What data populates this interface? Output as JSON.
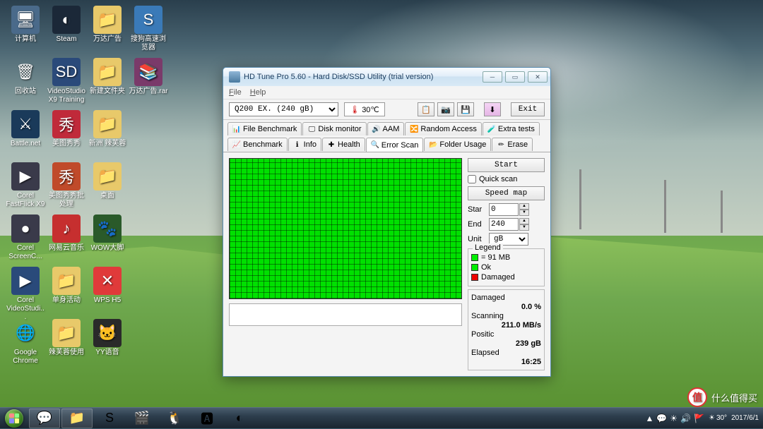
{
  "desktop_icons": [
    {
      "row": 0,
      "col": 0,
      "label": "计算机",
      "bg": "#4a6a8a",
      "glyph": "🖥"
    },
    {
      "row": 0,
      "col": 1,
      "label": "Steam",
      "bg": "#1b2838",
      "glyph": "◐"
    },
    {
      "row": 0,
      "col": 2,
      "label": "万达广告",
      "bg": "#e8c96a",
      "glyph": "📁"
    },
    {
      "row": 0,
      "col": 3,
      "label": "搜狗高速浏览器",
      "bg": "#3a7ab8",
      "glyph": "S"
    },
    {
      "row": 1,
      "col": 0,
      "label": "回收站",
      "bg": "transparent",
      "glyph": "🗑"
    },
    {
      "row": 1,
      "col": 1,
      "label": "VideoStudio X9 Training",
      "bg": "#2a4a7a",
      "glyph": "SD"
    },
    {
      "row": 1,
      "col": 2,
      "label": "新建文件夹",
      "bg": "#e8c96a",
      "glyph": "📁"
    },
    {
      "row": 1,
      "col": 3,
      "label": "万达广告.rar",
      "bg": "#7a3a6a",
      "glyph": "📚"
    },
    {
      "row": 2,
      "col": 0,
      "label": "Battle.net",
      "bg": "#1a3a5a",
      "glyph": "⚔"
    },
    {
      "row": 2,
      "col": 1,
      "label": "美图秀秀",
      "bg": "#c02a3a",
      "glyph": "秀"
    },
    {
      "row": 2,
      "col": 2,
      "label": "新洲 辣芙蓉",
      "bg": "#e8c96a",
      "glyph": "📁"
    },
    {
      "row": 3,
      "col": 0,
      "label": "Corel FastFlick X9",
      "bg": "#3a3a4a",
      "glyph": "▶"
    },
    {
      "row": 3,
      "col": 1,
      "label": "美图秀秀批处理",
      "bg": "#c04a2a",
      "glyph": "秀"
    },
    {
      "row": 3,
      "col": 2,
      "label": "桌面",
      "bg": "#e8c96a",
      "glyph": "📁"
    },
    {
      "row": 4,
      "col": 0,
      "label": "Corel ScreenC...",
      "bg": "#3a3a4a",
      "glyph": "●"
    },
    {
      "row": 4,
      "col": 1,
      "label": "网易云音乐",
      "bg": "#c62f2f",
      "glyph": "♪"
    },
    {
      "row": 4,
      "col": 2,
      "label": "WOW大脚",
      "bg": "#2a5a2a",
      "glyph": "🐾"
    },
    {
      "row": 5,
      "col": 0,
      "label": "Corel VideoStudi...",
      "bg": "#2a4a7a",
      "glyph": "▶"
    },
    {
      "row": 5,
      "col": 1,
      "label": "单身活动",
      "bg": "#e8c96a",
      "glyph": "📁"
    },
    {
      "row": 5,
      "col": 2,
      "label": "WPS H5",
      "bg": "#e03a3a",
      "glyph": "✕"
    },
    {
      "row": 6,
      "col": 0,
      "label": "Google Chrome",
      "bg": "transparent",
      "glyph": "🌐"
    },
    {
      "row": 6,
      "col": 1,
      "label": "辣芙蓉使用",
      "bg": "#e8c96a",
      "glyph": "📁"
    },
    {
      "row": 6,
      "col": 2,
      "label": "YY语音",
      "bg": "#2a2a2a",
      "glyph": "🐱"
    }
  ],
  "taskbar": {
    "pinned": [
      "💬",
      "📁",
      "S",
      "🎬",
      "🐧",
      "🅰",
      "◐"
    ],
    "tray_icons": [
      "▲",
      "💬",
      "☀",
      "🔊",
      "🚩"
    ],
    "temp": "30°",
    "time": "",
    "date": "2017/6/1"
  },
  "window": {
    "title": "HD Tune Pro 5.60 - Hard Disk/SSD Utility (trial version)",
    "menu": {
      "file": "File",
      "help": "Help"
    },
    "drive": "Q200 EX. (240 gB)",
    "temperature": "30℃",
    "exit": "Exit",
    "tabs_row1": [
      {
        "icon": "📊",
        "label": "File Benchmark"
      },
      {
        "icon": "🖵",
        "label": "Disk monitor"
      },
      {
        "icon": "🔊",
        "label": "AAM"
      },
      {
        "icon": "🔀",
        "label": "Random Access"
      },
      {
        "icon": "🧪",
        "label": "Extra tests"
      }
    ],
    "tabs_row2": [
      {
        "icon": "📈",
        "label": "Benchmark"
      },
      {
        "icon": "ℹ",
        "label": "Info"
      },
      {
        "icon": "✚",
        "label": "Health"
      },
      {
        "icon": "🔍",
        "label": "Error Scan",
        "active": true
      },
      {
        "icon": "📂",
        "label": "Folder Usage"
      },
      {
        "icon": "✏",
        "label": "Erase"
      }
    ],
    "start_btn": "Start",
    "quick_scan": "Quick scan",
    "speed_map": "Speed map",
    "fields": {
      "start": {
        "label": "Star",
        "value": "0"
      },
      "end": {
        "label": "End",
        "value": "240"
      },
      "unit": {
        "label": "Unit",
        "value": "gB"
      }
    },
    "legend": {
      "title": "Legend",
      "block": "= 91 MB",
      "ok": "Ok",
      "damaged": "Damaged"
    },
    "stats": {
      "damaged": {
        "label": "Damaged",
        "value": "0.0 %"
      },
      "scanning": {
        "label": "Scanning",
        "value": "211.0 MB/s"
      },
      "position": {
        "label": "Positic",
        "value": "239 gB"
      },
      "elapsed": {
        "label": "Elapsed",
        "value": "16:25"
      }
    }
  },
  "watermark": {
    "badge": "值",
    "text": "什么值得买"
  }
}
